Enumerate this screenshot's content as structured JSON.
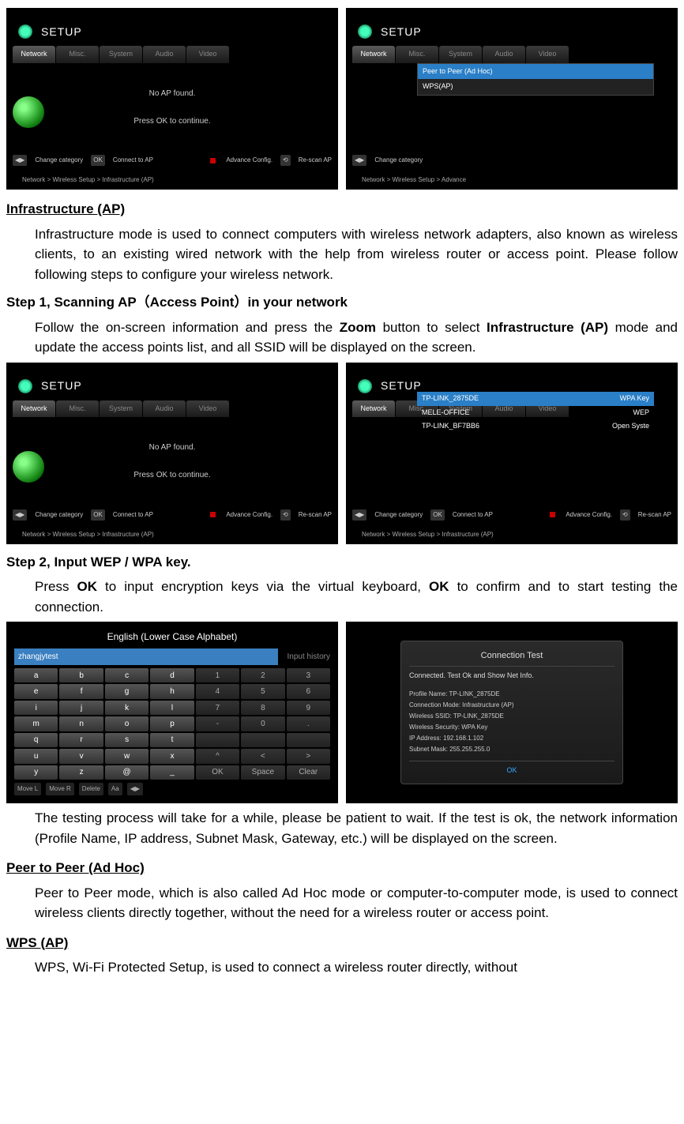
{
  "screenshots": {
    "setup_title": "SETUP",
    "tabs": [
      "Network",
      "Misc.",
      "System",
      "Audio",
      "Video"
    ],
    "no_ap_msg": "No AP found.",
    "press_ok_msg": "Press OK to continue.",
    "footer": {
      "change_cat": "Change category",
      "connect": "Connect to AP",
      "advance": "Advance Config.",
      "rescan": "Re-scan AP"
    },
    "breadcrumb1": "Network > Wireless Setup > Infrastructure (AP)",
    "breadcrumb2": "Network > Wireless Setup > Advance",
    "dropdown": {
      "item1": "Peer to Peer (Ad Hoc)",
      "item2": "WPS(AP)"
    },
    "ap_list": [
      {
        "ssid": "TP-LINK_2875DE",
        "sec": "WPA Key"
      },
      {
        "ssid": "MELE-OFFICE",
        "sec": "WEP"
      },
      {
        "ssid": "TP-LINK_BF7BB6",
        "sec": "Open Syste"
      }
    ]
  },
  "keyboard": {
    "title": "English (Lower Case Alphabet)",
    "input": "zhangjytest",
    "history": "Input history",
    "rows": [
      [
        "a",
        "b",
        "c",
        "d",
        "1",
        "2",
        "3"
      ],
      [
        "e",
        "f",
        "g",
        "h",
        "4",
        "5",
        "6"
      ],
      [
        "i",
        "j",
        "k",
        "l",
        "7",
        "8",
        "9"
      ],
      [
        "m",
        "n",
        "o",
        "p",
        "-",
        "0",
        "."
      ],
      [
        "q",
        "r",
        "s",
        "t",
        " ",
        " ",
        " "
      ],
      [
        "u",
        "v",
        "w",
        "x",
        "^",
        "<",
        ">"
      ],
      [
        "y",
        "z",
        "@",
        "_",
        "OK",
        "Space",
        "Clear"
      ]
    ],
    "bottom": [
      "Move L",
      "Move R",
      "Delete",
      "Aa",
      "◀▶"
    ]
  },
  "connection": {
    "title": "Connection Test",
    "msg": "Connected. Test Ok and Show Net Info.",
    "rows": [
      "Profile Name: TP-LINK_2875DE",
      "Connection Mode: Infrastructure (AP)",
      "Wireless SSID: TP-LINK_2875DE",
      "Wireless Security: WPA Key",
      "IP Address: 192.168.1.102",
      "Subnet Mask: 255.255.255.0"
    ],
    "ok": "OK"
  },
  "doc": {
    "h_infra": "Infrastructure (AP)",
    "p_infra": "Infrastructure mode is used to connect computers with wireless network adapters, also known as wireless clients, to an existing wired network with the help from wireless router or access point. Please follow following steps to configure your wireless network.",
    "step1": "Step 1, Scanning AP（Access Point）in your network",
    "p_step1a": "Follow the on-screen information and press the ",
    "p_step1_zoom": "Zoom",
    "p_step1b": " button to select ",
    "p_step1_infra": "Infrastructure (AP)",
    "p_step1c": " mode and update the access points list, and all SSID will be displayed on the screen.",
    "step2": "Step 2, Input WEP / WPA key.",
    "p_step2a": "Press ",
    "p_step2_ok1": "OK",
    "p_step2b": " to input encryption keys via the virtual keyboard, ",
    "p_step2_ok2": "OK",
    "p_step2c": " to confirm and to start testing the connection.",
    "p_testing": "The testing process will take for a while, please be patient to wait. If the test is ok, the network information (Profile Name, IP address, Subnet Mask, Gateway, etc.) will be displayed on the screen.",
    "h_peer": "Peer to Peer (Ad Hoc)",
    "p_peer": "Peer to Peer mode, which is also called Ad Hoc mode or computer-to-computer mode, is used to connect wireless clients directly together, without the need for a wireless router or access point.",
    "h_wps": "WPS (AP)",
    "p_wps": "WPS, Wi-Fi Protected Setup, is used to connect a wireless router directly, without"
  }
}
